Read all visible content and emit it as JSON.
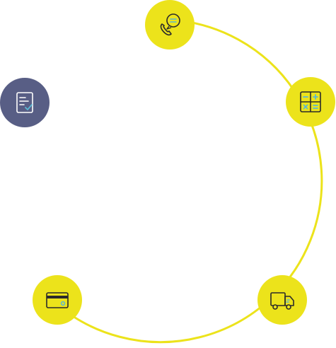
{
  "diagram": {
    "colors": {
      "accent": "#ece31b",
      "active": "#585e85",
      "icon_stroke": "#2b2b2b",
      "icon_detail": "#5bb8d3",
      "active_icon_stroke": "#ffffff"
    },
    "nodes": [
      {
        "id": "support",
        "icon": "phone-chat-icon",
        "active": false
      },
      {
        "id": "calculate",
        "icon": "calculator-icon",
        "active": false
      },
      {
        "id": "document",
        "icon": "document-check-icon",
        "active": true
      },
      {
        "id": "payment",
        "icon": "credit-card-icon",
        "active": false
      },
      {
        "id": "delivery",
        "icon": "delivery-truck-icon",
        "active": false
      }
    ]
  }
}
